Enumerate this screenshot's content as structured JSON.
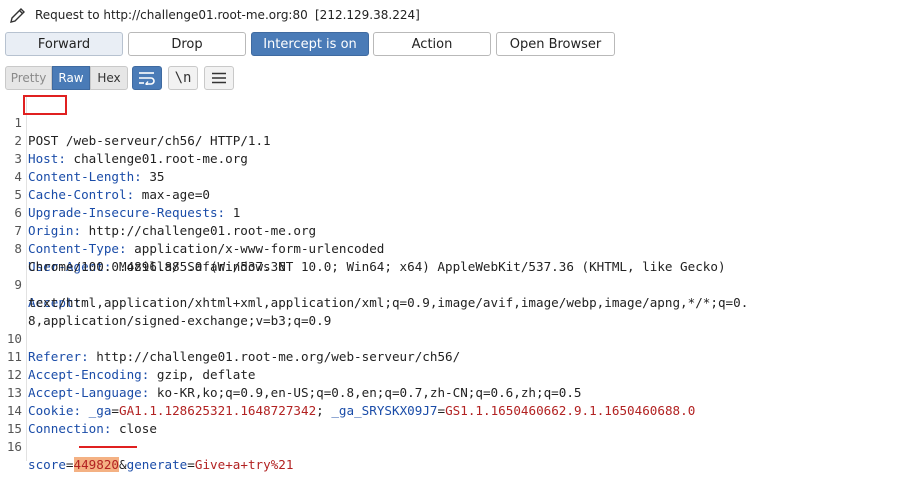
{
  "titlebar": {
    "icon": "pencil-icon",
    "text": "Request to http://challenge01.root-me.org:80",
    "ip": "[212.129.38.224]"
  },
  "buttons": {
    "forward": "Forward",
    "drop": "Drop",
    "intercept": "Intercept is on",
    "action": "Action",
    "open_browser": "Open Browser"
  },
  "view_tabs": {
    "pretty": "Pretty",
    "raw": "Raw",
    "hex": "Hex",
    "newline": "\\n"
  },
  "colors": {
    "accent": "#4a7bb7",
    "header_key": "#1a4ca8",
    "cookie_value": "#b22222",
    "highlight": "#f4b183",
    "annotation": "#e02020"
  },
  "request": {
    "l1": {
      "num": "1",
      "method": "POST",
      "rest": " /web-serveur/ch56/ HTTP/1.1"
    },
    "l2": {
      "num": "2",
      "key": "Host:",
      "val": " challenge01.root-me.org"
    },
    "l3": {
      "num": "3",
      "key": "Content-Length:",
      "val": " 35"
    },
    "l4": {
      "num": "4",
      "key": "Cache-Control:",
      "val": " max-age=0"
    },
    "l5": {
      "num": "5",
      "key": "Upgrade-Insecure-Requests:",
      "val": " 1"
    },
    "l6": {
      "num": "6",
      "key": "Origin:",
      "val": " http://challenge01.root-me.org"
    },
    "l7": {
      "num": "7",
      "key": "Content-Type:",
      "val": " application/x-www-form-urlencoded"
    },
    "l8": {
      "num": "8",
      "key": "User-Agent:",
      "val": " Mozilla/5.0 (Windows NT 10.0; Win64; x64) AppleWebKit/537.36 (KHTML, like Gecko)",
      "cont": "Chrome/100.0.4896.88 Safari/537.36"
    },
    "l9": {
      "num": "9",
      "key": "Accept:",
      "cont1": "text/html,application/xhtml+xml,application/xml;q=0.9,image/avif,image/webp,image/apng,*/*;q=0.",
      "cont2": "8,application/signed-exchange;v=b3;q=0.9"
    },
    "l10": {
      "num": "10",
      "key": "Referer:",
      "val": " http://challenge01.root-me.org/web-serveur/ch56/"
    },
    "l11": {
      "num": "11",
      "key": "Accept-Encoding:",
      "val": " gzip, deflate"
    },
    "l12": {
      "num": "12",
      "key": "Accept-Language:",
      "val": " ko-KR,ko;q=0.9,en-US;q=0.8,en;q=0.7,zh-CN;q=0.6,zh;q=0.5"
    },
    "l13": {
      "num": "13",
      "key": "Cookie:",
      "sp": " ",
      "c1k": "_ga",
      "eq1": "=",
      "c1v": "GA1.1.128625321.1648727342",
      "sep": "; ",
      "c2k": "_ga_SRYSKX09J7",
      "eq2": "=",
      "c2v": "GS1.1.1650460662.9.1.1650460688.0"
    },
    "l14": {
      "num": "14",
      "key": "Connection:",
      "val": " close"
    },
    "l15": {
      "num": "15"
    },
    "l16": {
      "num": "16",
      "p1k": "score",
      "eq1": "=",
      "p1v": "449820",
      "amp": "&",
      "p2k": "generate",
      "eq2": "=",
      "p2v": "Give+a+try%21"
    }
  }
}
